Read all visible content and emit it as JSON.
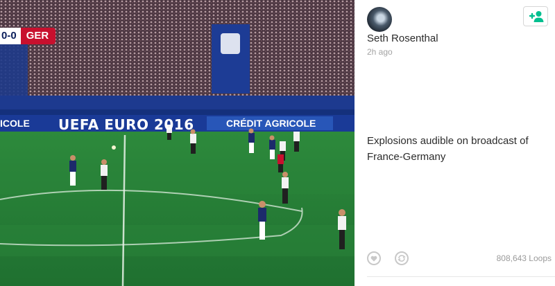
{
  "video": {
    "score": "0-0",
    "team": "GER",
    "board_left": "ICOLE",
    "board_euro": "UEFA EURO 2016",
    "board_sponsor": "CRÉDIT AGRICOLE"
  },
  "post": {
    "author": "Seth Rosenthal",
    "time": "2h ago",
    "description": "Explosions audible on broadcast of France-Germany",
    "loops": "808,643 Loops"
  },
  "icons": {
    "follow": "add-user-icon",
    "like": "heart-icon",
    "revine": "revine-icon"
  },
  "colors": {
    "accent": "#00bf8f",
    "pitch": "#1f7a33"
  }
}
